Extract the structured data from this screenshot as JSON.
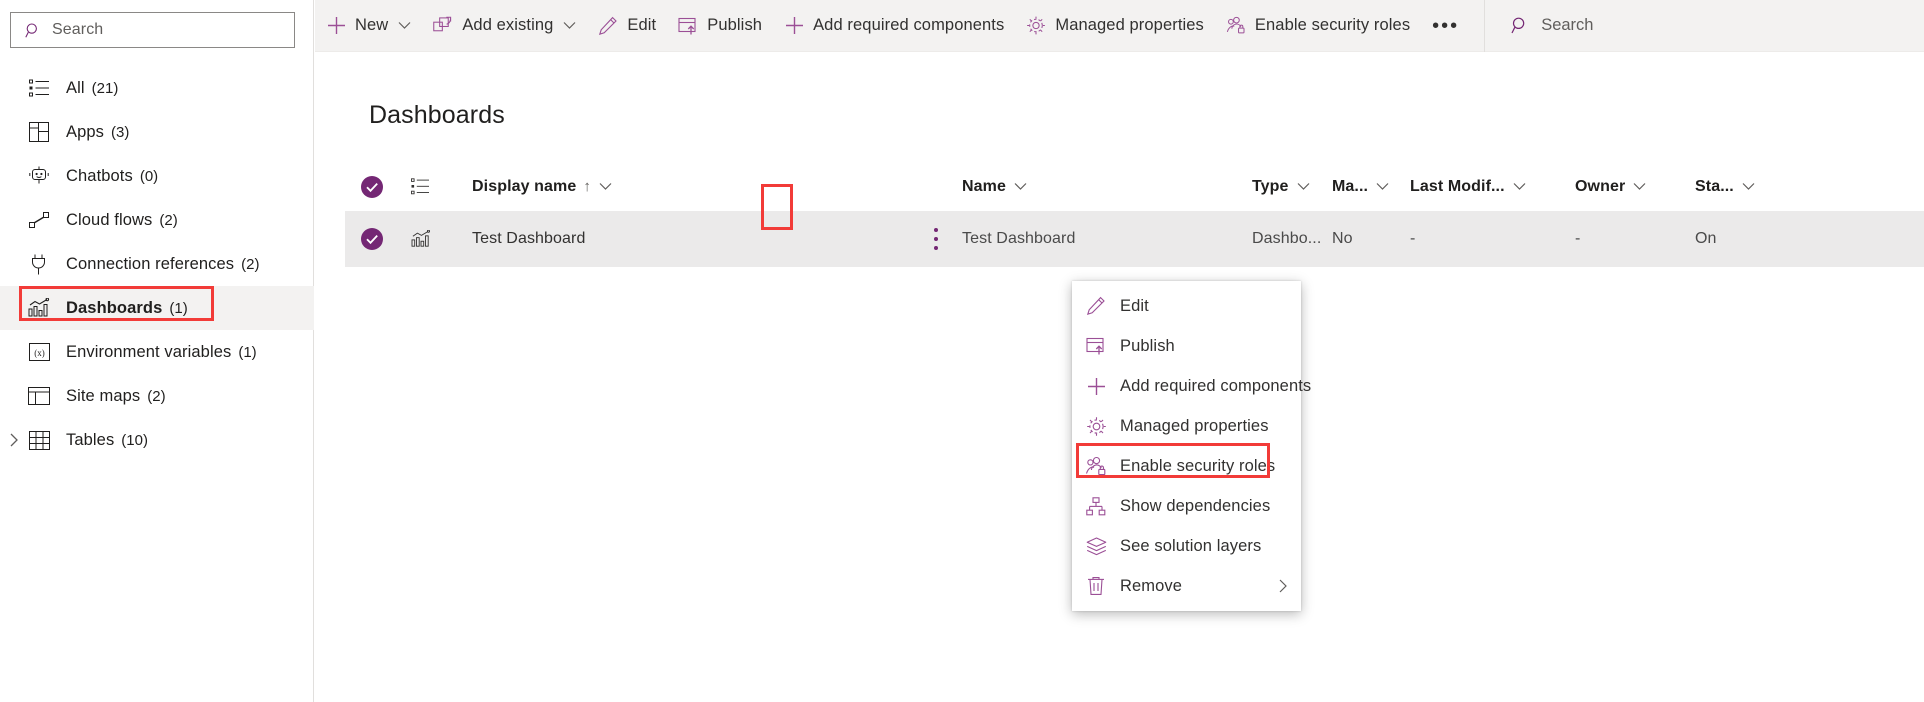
{
  "sidebar": {
    "search": {
      "placeholder": "Search",
      "icon": "search-icon"
    },
    "items": [
      {
        "label": "All",
        "count": "(21)",
        "icon": "list-icon",
        "selected": false,
        "expandable": false
      },
      {
        "label": "Apps",
        "count": "(3)",
        "icon": "apps-grid-icon",
        "selected": false,
        "expandable": false
      },
      {
        "label": "Chatbots",
        "count": "(0)",
        "icon": "chatbot-icon",
        "selected": false,
        "expandable": false
      },
      {
        "label": "Cloud flows",
        "count": "(2)",
        "icon": "cloud-flow-icon",
        "selected": false,
        "expandable": false
      },
      {
        "label": "Connection references",
        "count": "(2)",
        "icon": "connection-reference-icon",
        "selected": false,
        "expandable": false
      },
      {
        "label": "Dashboards",
        "count": "(1)",
        "icon": "dashboard-chart-icon",
        "selected": true,
        "expandable": false
      },
      {
        "label": "Environment variables",
        "count": "(1)",
        "icon": "environment-variable-icon",
        "selected": false,
        "expandable": false
      },
      {
        "label": "Site maps",
        "count": "(2)",
        "icon": "site-map-icon",
        "selected": false,
        "expandable": false
      },
      {
        "label": "Tables",
        "count": "(10)",
        "icon": "table-icon",
        "selected": false,
        "expandable": true
      }
    ]
  },
  "commandbar": {
    "items": [
      {
        "label": "New",
        "icon": "plus-icon",
        "caret": true
      },
      {
        "label": "Add existing",
        "icon": "add-existing-icon",
        "caret": true
      },
      {
        "label": "Edit",
        "icon": "pencil-icon",
        "caret": false
      },
      {
        "label": "Publish",
        "icon": "publish-icon",
        "caret": false
      },
      {
        "label": "Add required components",
        "icon": "plus-icon",
        "caret": false
      },
      {
        "label": "Managed properties",
        "icon": "gear-icon",
        "caret": false
      },
      {
        "label": "Enable security roles",
        "icon": "security-roles-icon",
        "caret": false
      }
    ],
    "overflow_label": "•••",
    "search": {
      "label": "Search",
      "icon": "search-icon"
    }
  },
  "main": {
    "title": "Dashboards",
    "table": {
      "columns": [
        {
          "key": "display_name",
          "label": "Display name",
          "sort": "↑",
          "caret": true
        },
        {
          "key": "name",
          "label": "Name",
          "sort": "",
          "caret": true
        },
        {
          "key": "type",
          "label": "Type",
          "sort": "",
          "caret": true
        },
        {
          "key": "managed",
          "label": "Ma...",
          "sort": "",
          "caret": true
        },
        {
          "key": "modified",
          "label": "Last Modif...",
          "sort": "",
          "caret": true
        },
        {
          "key": "owner",
          "label": "Owner",
          "sort": "",
          "caret": true
        },
        {
          "key": "state",
          "label": "Sta...",
          "sort": "",
          "caret": true
        }
      ],
      "rows": [
        {
          "selected": true,
          "row_icon": "dashboard-chart-icon",
          "display_name": "Test Dashboard",
          "name": "Test Dashboard",
          "type": "Dashbo...",
          "managed": "No",
          "modified": "-",
          "owner": "-",
          "state": "On"
        }
      ]
    }
  },
  "context_menu": {
    "items": [
      {
        "label": "Edit",
        "icon": "pencil-icon",
        "submenu": false,
        "highlighted": false
      },
      {
        "label": "Publish",
        "icon": "publish-icon",
        "submenu": false,
        "highlighted": false
      },
      {
        "label": "Add required components",
        "icon": "plus-icon",
        "submenu": false,
        "highlighted": false
      },
      {
        "label": "Managed properties",
        "icon": "gear-icon",
        "submenu": false,
        "highlighted": false
      },
      {
        "label": "Enable security roles",
        "icon": "security-roles-icon",
        "submenu": false,
        "highlighted": true
      },
      {
        "label": "Show dependencies",
        "icon": "dependencies-icon",
        "submenu": false,
        "highlighted": false
      },
      {
        "label": "See solution layers",
        "icon": "layers-icon",
        "submenu": false,
        "highlighted": false
      },
      {
        "label": "Remove",
        "icon": "trash-icon",
        "submenu": true,
        "highlighted": false
      }
    ]
  },
  "colors": {
    "accent_purple": "#742774",
    "highlight_red": "#f23b38",
    "commandbar_bg": "#f3f2f1",
    "row_selected_bg": "#ebeaea",
    "text_primary": "#201f1e"
  }
}
